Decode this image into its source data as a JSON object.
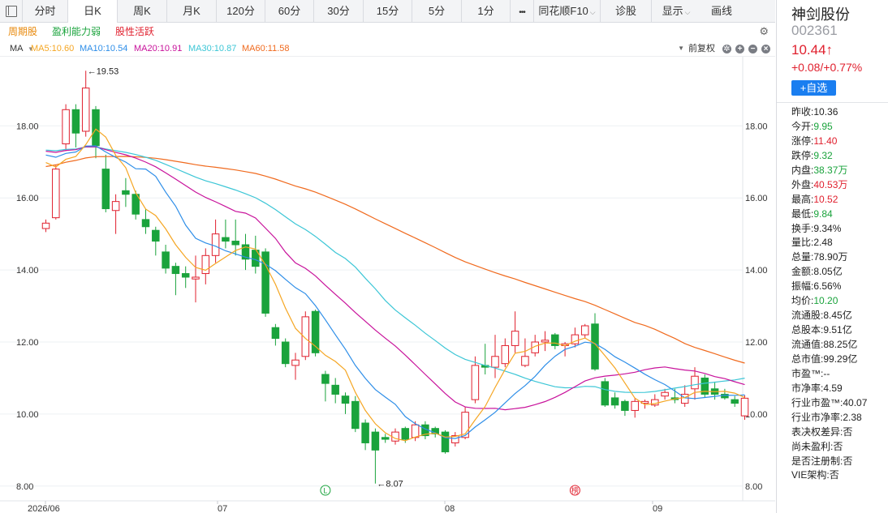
{
  "tabs": [
    {
      "id": "layout",
      "label": "",
      "icon": "layout-icon"
    },
    {
      "id": "fenshi",
      "label": "分时"
    },
    {
      "id": "rik",
      "label": "日K",
      "active": true
    },
    {
      "id": "zhouk",
      "label": "周K"
    },
    {
      "id": "yuek",
      "label": "月K"
    },
    {
      "id": "m120",
      "label": "120分"
    },
    {
      "id": "m60",
      "label": "60分"
    },
    {
      "id": "m30",
      "label": "30分"
    },
    {
      "id": "m15",
      "label": "15分"
    },
    {
      "id": "m5",
      "label": "5分"
    },
    {
      "id": "m1",
      "label": "1分"
    },
    {
      "id": "more",
      "label": "•••"
    },
    {
      "id": "f10",
      "label": "同花顺F10",
      "dropdown": true
    },
    {
      "id": "zhengu",
      "label": "诊股"
    },
    {
      "id": "show",
      "label": "显示",
      "dropdown": true
    },
    {
      "id": "draw",
      "label": "画线"
    }
  ],
  "indicators": [
    {
      "label": "周期股",
      "color": "#e8890c"
    },
    {
      "label": "盈利能力弱",
      "color": "#1aa33c"
    },
    {
      "label": "股性活跃",
      "color": "#e0202e"
    }
  ],
  "ma_bar": {
    "ma_label": "MA",
    "items": [
      {
        "label": "MA5:10.60",
        "color": "#f5a623"
      },
      {
        "label": "MA10:10.54",
        "color": "#2e8ee8"
      },
      {
        "label": "MA20:10.91",
        "color": "#c8129b"
      },
      {
        "label": "MA30:10.87",
        "color": "#3cc6d6"
      },
      {
        "label": "MA60:11.58",
        "color": "#f06a1e"
      }
    ],
    "adjust": "前复权"
  },
  "chart_data": {
    "type": "candlestick",
    "yticks": [
      "18.00",
      "16.00",
      "14.00",
      "12.00",
      "10.00",
      "8.00"
    ],
    "xticks": [
      "2026/06",
      "07",
      "08",
      "09"
    ],
    "annotations": {
      "high": "←19.53",
      "low": "←8.07"
    },
    "event_markers": [
      {
        "text": "L",
        "color": "#1aa33c"
      },
      {
        "text": "榜",
        "color": "#e0202e"
      }
    ],
    "colors": {
      "up": "#e0202e",
      "down": "#1aa33c"
    },
    "candles": [
      {
        "o": 15.15,
        "c": 15.3,
        "h": 15.4,
        "l": 15.05
      },
      {
        "o": 15.45,
        "c": 16.8,
        "h": 16.9,
        "l": 15.4
      },
      {
        "o": 17.5,
        "c": 18.45,
        "h": 18.6,
        "l": 17.3
      },
      {
        "o": 18.45,
        "c": 17.8,
        "h": 18.6,
        "l": 17.4
      },
      {
        "o": 17.85,
        "c": 19.05,
        "h": 19.53,
        "l": 17.7
      },
      {
        "o": 18.45,
        "c": 17.45,
        "h": 18.55,
        "l": 17.1
      },
      {
        "o": 16.8,
        "c": 15.7,
        "h": 17.2,
        "l": 15.6
      },
      {
        "o": 15.65,
        "c": 15.9,
        "h": 16.1,
        "l": 15.0
      },
      {
        "o": 16.2,
        "c": 16.1,
        "h": 16.55,
        "l": 15.75
      },
      {
        "o": 16.1,
        "c": 15.55,
        "h": 16.2,
        "l": 15.4
      },
      {
        "o": 15.4,
        "c": 15.2,
        "h": 15.7,
        "l": 15.0
      },
      {
        "o": 15.1,
        "c": 14.8,
        "h": 15.2,
        "l": 14.4
      },
      {
        "o": 14.5,
        "c": 14.05,
        "h": 14.7,
        "l": 13.9
      },
      {
        "o": 14.1,
        "c": 13.9,
        "h": 14.2,
        "l": 13.3
      },
      {
        "o": 13.9,
        "c": 13.8,
        "h": 14.1,
        "l": 13.5
      },
      {
        "o": 13.75,
        "c": 13.8,
        "h": 14.4,
        "l": 13.1
      },
      {
        "o": 13.9,
        "c": 14.4,
        "h": 14.6,
        "l": 13.6
      },
      {
        "o": 14.4,
        "c": 15.0,
        "h": 15.4,
        "l": 14.2
      },
      {
        "o": 14.9,
        "c": 14.8,
        "h": 15.4,
        "l": 14.6
      },
      {
        "o": 14.8,
        "c": 14.7,
        "h": 15.4,
        "l": 14.4
      },
      {
        "o": 14.7,
        "c": 14.3,
        "h": 15.0,
        "l": 14.0
      },
      {
        "o": 14.55,
        "c": 14.1,
        "h": 14.95,
        "l": 13.9
      },
      {
        "o": 14.5,
        "c": 12.8,
        "h": 14.6,
        "l": 12.7
      },
      {
        "o": 12.4,
        "c": 12.1,
        "h": 12.5,
        "l": 11.9
      },
      {
        "o": 12.0,
        "c": 11.4,
        "h": 12.1,
        "l": 11.3
      },
      {
        "o": 11.35,
        "c": 11.5,
        "h": 11.7,
        "l": 10.95
      },
      {
        "o": 11.6,
        "c": 12.7,
        "h": 12.85,
        "l": 11.5
      },
      {
        "o": 12.85,
        "c": 11.7,
        "h": 12.9,
        "l": 11.6
      },
      {
        "o": 11.1,
        "c": 10.85,
        "h": 11.2,
        "l": 10.35
      },
      {
        "o": 10.8,
        "c": 10.55,
        "h": 11.0,
        "l": 10.3
      },
      {
        "o": 10.5,
        "c": 10.3,
        "h": 10.6,
        "l": 10.0
      },
      {
        "o": 10.35,
        "c": 9.6,
        "h": 10.5,
        "l": 9.5
      },
      {
        "o": 9.75,
        "c": 9.2,
        "h": 9.85,
        "l": 9.0
      },
      {
        "o": 9.5,
        "c": 9.0,
        "h": 9.6,
        "l": 8.07
      },
      {
        "o": 9.35,
        "c": 9.3,
        "h": 9.45,
        "l": 9.2
      },
      {
        "o": 9.25,
        "c": 9.5,
        "h": 9.6,
        "l": 9.15
      },
      {
        "o": 9.6,
        "c": 9.3,
        "h": 9.65,
        "l": 9.2
      },
      {
        "o": 9.35,
        "c": 9.7,
        "h": 9.8,
        "l": 9.25
      },
      {
        "o": 9.7,
        "c": 9.4,
        "h": 9.8,
        "l": 9.3
      },
      {
        "o": 9.6,
        "c": 9.45,
        "h": 9.65,
        "l": 9.35
      },
      {
        "o": 9.5,
        "c": 8.95,
        "h": 9.55,
        "l": 8.9
      },
      {
        "o": 9.2,
        "c": 9.4,
        "h": 9.5,
        "l": 9.1
      },
      {
        "o": 9.35,
        "c": 10.05,
        "h": 10.2,
        "l": 9.3
      },
      {
        "o": 10.4,
        "c": 11.35,
        "h": 11.6,
        "l": 10.3
      },
      {
        "o": 11.35,
        "c": 11.3,
        "h": 11.95,
        "l": 11.1
      },
      {
        "o": 11.3,
        "c": 11.6,
        "h": 12.2,
        "l": 11.0
      },
      {
        "o": 11.4,
        "c": 11.9,
        "h": 12.1,
        "l": 11.3
      },
      {
        "o": 11.9,
        "c": 12.3,
        "h": 12.85,
        "l": 11.7
      },
      {
        "o": 11.35,
        "c": 11.6,
        "h": 12.1,
        "l": 11.3
      },
      {
        "o": 11.7,
        "c": 12.0,
        "h": 12.2,
        "l": 11.6
      },
      {
        "o": 12.0,
        "c": 12.05,
        "h": 12.3,
        "l": 11.75
      },
      {
        "o": 12.2,
        "c": 11.9,
        "h": 12.25,
        "l": 11.8
      },
      {
        "o": 11.9,
        "c": 11.95,
        "h": 12.0,
        "l": 11.6
      },
      {
        "o": 11.95,
        "c": 12.2,
        "h": 12.4,
        "l": 11.85
      },
      {
        "o": 12.2,
        "c": 12.45,
        "h": 12.5,
        "l": 12.1
      },
      {
        "o": 12.5,
        "c": 11.25,
        "h": 12.8,
        "l": 11.2
      },
      {
        "o": 10.9,
        "c": 10.25,
        "h": 11.0,
        "l": 10.2
      },
      {
        "o": 10.45,
        "c": 10.25,
        "h": 10.6,
        "l": 10.15
      },
      {
        "o": 10.35,
        "c": 10.1,
        "h": 10.4,
        "l": 9.95
      },
      {
        "o": 10.1,
        "c": 10.35,
        "h": 10.45,
        "l": 9.9
      },
      {
        "o": 10.3,
        "c": 10.35,
        "h": 10.4,
        "l": 10.15
      },
      {
        "o": 10.25,
        "c": 10.4,
        "h": 10.55,
        "l": 10.2
      },
      {
        "o": 10.5,
        "c": 10.6,
        "h": 10.7,
        "l": 10.4
      },
      {
        "o": 10.45,
        "c": 10.4,
        "h": 10.7,
        "l": 10.3
      },
      {
        "o": 10.3,
        "c": 10.55,
        "h": 10.8,
        "l": 10.2
      },
      {
        "o": 10.7,
        "c": 11.05,
        "h": 11.3,
        "l": 10.4
      },
      {
        "o": 11.0,
        "c": 10.55,
        "h": 11.1,
        "l": 10.45
      },
      {
        "o": 10.7,
        "c": 10.55,
        "h": 10.9,
        "l": 10.4
      },
      {
        "o": 10.55,
        "c": 10.45,
        "h": 10.7,
        "l": 10.4
      },
      {
        "o": 10.4,
        "c": 10.3,
        "h": 10.5,
        "l": 10.2
      },
      {
        "o": 9.95,
        "c": 10.44,
        "h": 10.52,
        "l": 9.84
      }
    ]
  },
  "sidebar": {
    "name": "神剑股份",
    "code": "002361",
    "price": "10.44",
    "arrow": "↑",
    "change": "+0.08/+0.77%",
    "add_label": "+自选",
    "stats": [
      {
        "label": "昨收:",
        "value": "10.36",
        "color": "flat"
      },
      {
        "label": "今开:",
        "value": "9.95",
        "color": "down"
      },
      {
        "label": "涨停:",
        "value": "11.40",
        "color": "up"
      },
      {
        "label": "跌停:",
        "value": "9.32",
        "color": "down"
      },
      {
        "label": "内盘:",
        "value": "38.37万",
        "color": "down"
      },
      {
        "label": "外盘:",
        "value": "40.53万",
        "color": "up"
      },
      {
        "label": "最高:",
        "value": "10.52",
        "color": "up"
      },
      {
        "label": "最低:",
        "value": "9.84",
        "color": "down"
      },
      {
        "label": "换手:",
        "value": "9.34%",
        "color": "flat"
      },
      {
        "label": "量比:",
        "value": "2.48",
        "color": "flat"
      },
      {
        "label": "总量:",
        "value": "78.90万",
        "color": "flat"
      },
      {
        "label": "金额:",
        "value": "8.05亿",
        "color": "flat"
      },
      {
        "label": "振幅:",
        "value": "6.56%",
        "color": "flat"
      },
      {
        "label": "均价:",
        "value": "10.20",
        "color": "down"
      },
      {
        "label": "流通股:",
        "value": "8.45亿",
        "color": "flat"
      },
      {
        "label": "总股本:",
        "value": "9.51亿",
        "color": "flat"
      },
      {
        "label": "流通值:",
        "value": "88.25亿",
        "color": "flat"
      },
      {
        "label": "总市值:",
        "value": "99.29亿",
        "color": "flat"
      },
      {
        "label": "市盈™:",
        "value": "--",
        "color": "flat"
      },
      {
        "label": "市净率:",
        "value": "4.59",
        "color": "flat"
      },
      {
        "label": "行业市盈™:",
        "value": "40.07",
        "color": "flat"
      },
      {
        "label": "行业市净率:",
        "value": "2.38",
        "color": "flat"
      },
      {
        "label": "表决权差异:",
        "value": "否",
        "color": "flat"
      },
      {
        "label": "尚未盈利:",
        "value": "否",
        "color": "flat"
      },
      {
        "label": "是否注册制:",
        "value": "否",
        "color": "flat"
      },
      {
        "label": "VIE架构:",
        "value": "否",
        "color": "flat"
      }
    ]
  }
}
